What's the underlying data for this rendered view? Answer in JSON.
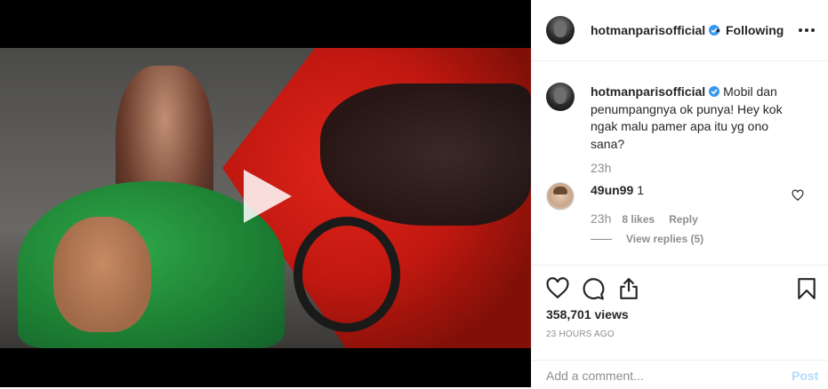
{
  "post": {
    "username": "hotmanparisofficial",
    "follow_separator": "•",
    "follow_status": "Following",
    "caption": "Mobil dan penumpangnya ok punya! Hey kok ngak malu pamer apa itu yg ono sana?",
    "caption_time": "23h",
    "views": "358,701 views",
    "posted": "23 HOURS AGO"
  },
  "comment": {
    "username": "49un99",
    "text": "1",
    "time": "23h",
    "likes": "8 likes",
    "reply_label": "Reply",
    "view_replies": "View replies (5)"
  },
  "add_comment": {
    "placeholder": "Add a comment...",
    "post_label": "Post"
  },
  "colors": {
    "verified": "#3897f0",
    "post_button_disabled": "#b3dbff",
    "muted_text": "#8e8e8e",
    "text": "#262626"
  },
  "icons": [
    "play-icon",
    "verified-badge-icon",
    "more-options-icon",
    "heart-icon",
    "comment-icon",
    "share-icon",
    "bookmark-icon"
  ]
}
